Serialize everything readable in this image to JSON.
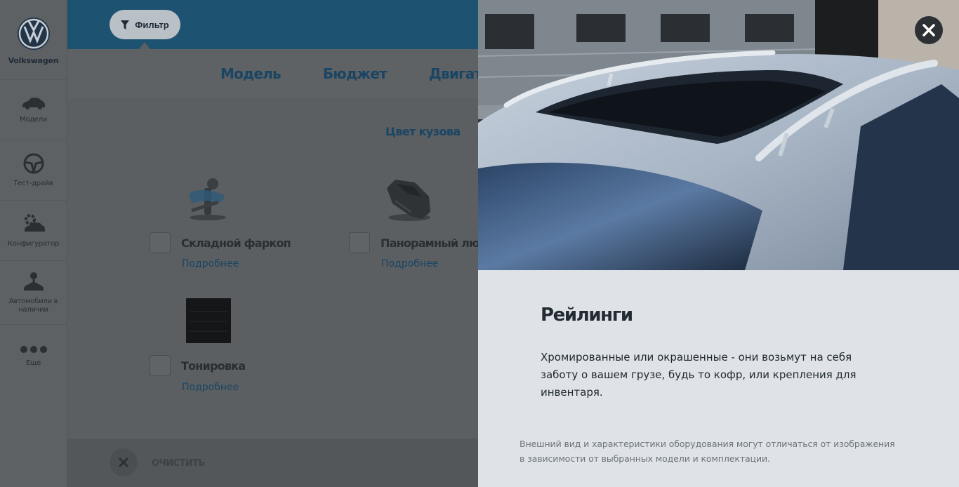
{
  "sidebar": {
    "brand": "Volkswagen",
    "items": [
      {
        "label": "Модели",
        "icon": "car-icon"
      },
      {
        "label": "Тест-драйв",
        "icon": "steering-wheel-icon"
      },
      {
        "label": "Конфигуратор",
        "icon": "configurator-icon"
      },
      {
        "label": "Автомобили в наличии",
        "icon": "car-stock-icon"
      },
      {
        "label": "Еще",
        "icon": "more-dots-icon"
      }
    ]
  },
  "filter": {
    "label": "Фильтр",
    "icon": "filter-icon"
  },
  "tabs": [
    {
      "label": "Модель"
    },
    {
      "label": "Бюджет"
    },
    {
      "label": "Двигатель"
    }
  ],
  "subtab": "Цвет кузова",
  "options": [
    {
      "title": "Складной фаркоп",
      "more": "Подробнее"
    },
    {
      "title": "Панорамный люк",
      "more": "Подробнее"
    },
    {
      "title": "Тонировка",
      "more": "Подробнее"
    }
  ],
  "footer": {
    "clear_label": "ОЧИСТИТЬ"
  },
  "detail": {
    "title": "Рейлинги",
    "description": "Хромированные или окрашенные - они возьмут на себя заботу о вашем грузе, будь то кофр, или крепления для инвентаря.",
    "note": "Внешний вид и характеристики оборудования могут отличаться от изображения в зависимости от выбранных модели и комплектации."
  },
  "colors": {
    "accent_blue": "#1a4563",
    "topbar": "#1e5271",
    "panel_bg": "#dfe3e7"
  }
}
